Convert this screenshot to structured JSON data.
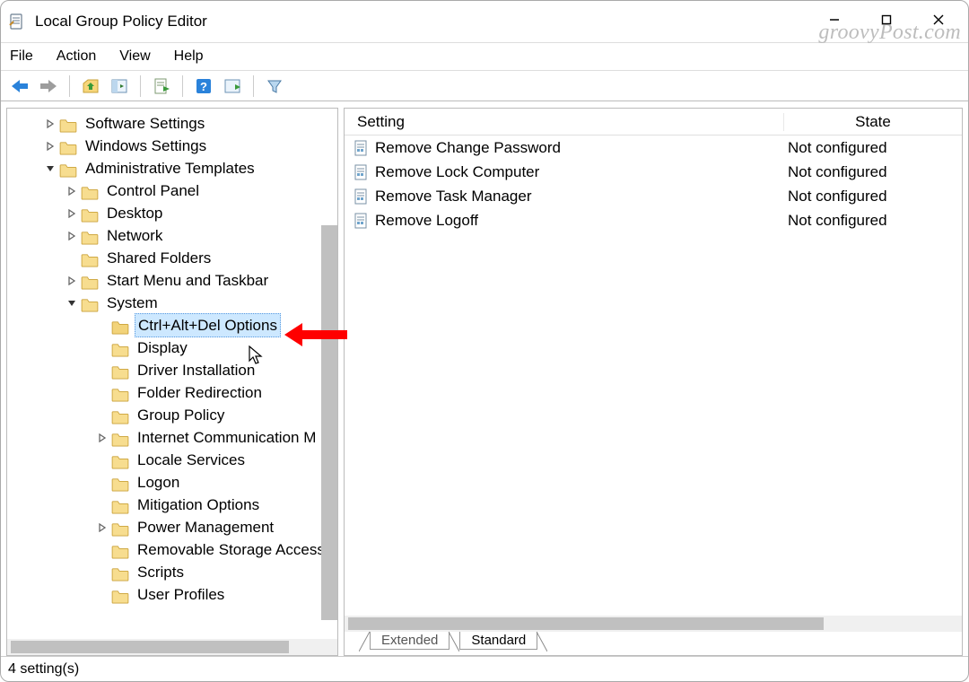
{
  "window": {
    "title": "Local Group Policy Editor",
    "watermark": "groovyPost.com"
  },
  "menu": {
    "file": "File",
    "action": "Action",
    "view": "View",
    "help": "Help"
  },
  "tree": {
    "items": [
      {
        "label": "Software Settings",
        "indent": 1,
        "exp": "right",
        "selected": false
      },
      {
        "label": "Windows Settings",
        "indent": 1,
        "exp": "right",
        "selected": false
      },
      {
        "label": "Administrative Templates",
        "indent": 1,
        "exp": "down",
        "selected": false
      },
      {
        "label": "Control Panel",
        "indent": 2,
        "exp": "right",
        "selected": false
      },
      {
        "label": "Desktop",
        "indent": 2,
        "exp": "right",
        "selected": false
      },
      {
        "label": "Network",
        "indent": 2,
        "exp": "right",
        "selected": false
      },
      {
        "label": "Shared Folders",
        "indent": 2,
        "exp": "",
        "selected": false
      },
      {
        "label": "Start Menu and Taskbar",
        "indent": 2,
        "exp": "right",
        "selected": false
      },
      {
        "label": "System",
        "indent": 2,
        "exp": "down",
        "selected": false
      },
      {
        "label": "Ctrl+Alt+Del Options",
        "indent": 3,
        "exp": "",
        "selected": true
      },
      {
        "label": "Display",
        "indent": 3,
        "exp": "",
        "selected": false
      },
      {
        "label": "Driver Installation",
        "indent": 3,
        "exp": "",
        "selected": false
      },
      {
        "label": "Folder Redirection",
        "indent": 3,
        "exp": "",
        "selected": false
      },
      {
        "label": "Group Policy",
        "indent": 3,
        "exp": "",
        "selected": false
      },
      {
        "label": "Internet Communication M",
        "indent": 3,
        "exp": "right",
        "selected": false
      },
      {
        "label": "Locale Services",
        "indent": 3,
        "exp": "",
        "selected": false
      },
      {
        "label": "Logon",
        "indent": 3,
        "exp": "",
        "selected": false
      },
      {
        "label": "Mitigation Options",
        "indent": 3,
        "exp": "",
        "selected": false
      },
      {
        "label": "Power Management",
        "indent": 3,
        "exp": "right",
        "selected": false
      },
      {
        "label": "Removable Storage Access",
        "indent": 3,
        "exp": "",
        "selected": false
      },
      {
        "label": "Scripts",
        "indent": 3,
        "exp": "",
        "selected": false
      },
      {
        "label": "User Profiles",
        "indent": 3,
        "exp": "",
        "selected": false
      }
    ]
  },
  "grid": {
    "headers": {
      "setting": "Setting",
      "state": "State"
    },
    "rows": [
      {
        "name": "Remove Change Password",
        "state": "Not configured"
      },
      {
        "name": "Remove Lock Computer",
        "state": "Not configured"
      },
      {
        "name": "Remove Task Manager",
        "state": "Not configured"
      },
      {
        "name": "Remove Logoff",
        "state": "Not configured"
      }
    ]
  },
  "tabs": {
    "extended": "Extended",
    "standard": "Standard"
  },
  "status": {
    "text": "4 setting(s)"
  }
}
